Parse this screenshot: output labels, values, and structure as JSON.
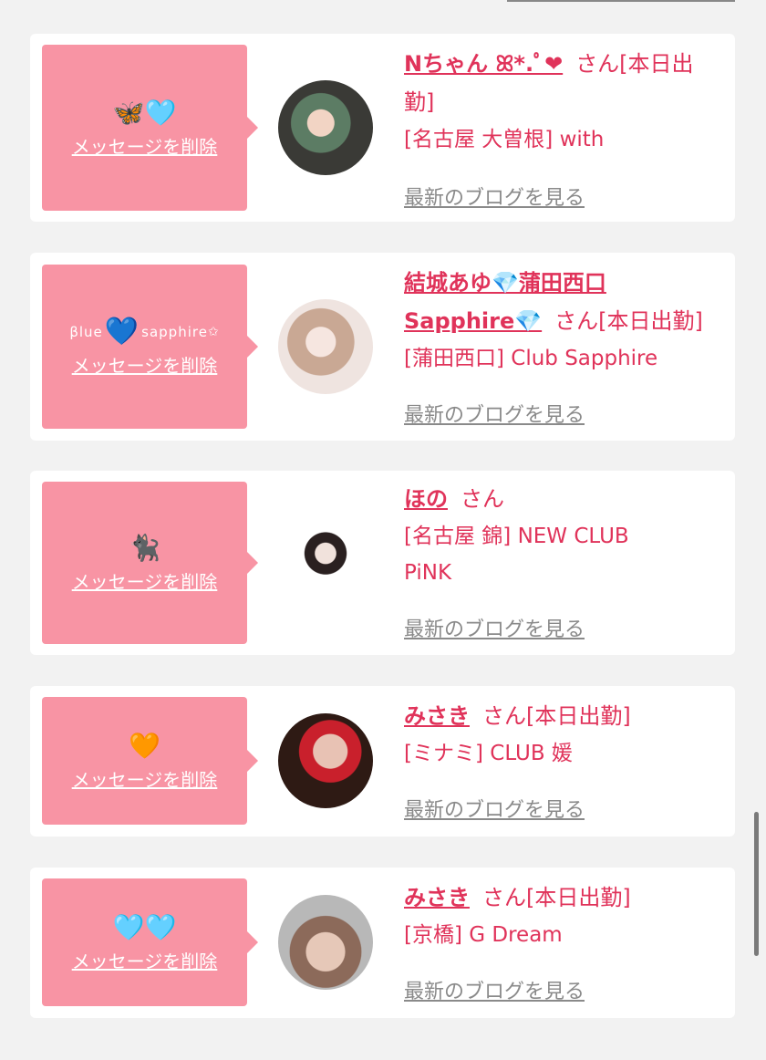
{
  "top": {
    "paren": "( )"
  },
  "cards": [
    {
      "message_emoji": "🦋🩵",
      "delete_label": "メッセージを削除",
      "name": "Nちゃん ꕤ*.ﾟ❤︎",
      "honorific_status": "さん[本日出勤]",
      "shop": "[名古屋 大曽根] with",
      "blog_label": "最新のブログを見る"
    },
    {
      "message_prefix": "βlue",
      "message_heart": "💙",
      "message_suffix": "sapphire",
      "message_star": "✩",
      "delete_label": "メッセージを削除",
      "name_line1": "結城あゆ💎蒲田西口",
      "name_line2": "Sapphire💎",
      "honorific_status": "さん[本日出勤]",
      "shop": "[蒲田西口] Club Sapphire",
      "blog_label": "最新のブログを見る"
    },
    {
      "message_emoji": "🐈‍⬛",
      "delete_label": "メッセージを削除",
      "name": "ほの",
      "honorific": "さん",
      "shop_line1": "[名古屋 錦] NEW CLUB",
      "shop_line2": "PiNK",
      "blog_label": "最新のブログを見る"
    },
    {
      "message_emoji": "🧡",
      "delete_label": "メッセージを削除",
      "name": "みさき",
      "honorific_status": "さん[本日出勤]",
      "shop": "[ミナミ] CLUB 媛",
      "blog_label": "最新のブログを見る"
    },
    {
      "message_emoji": "🩵🩵",
      "delete_label": "メッセージを削除",
      "name": "みさき",
      "honorific_status": "さん[本日出勤]",
      "shop": "[京橋] G Dream",
      "blog_label": "最新のブログを見る"
    }
  ],
  "colors": {
    "accent": "#e0335a",
    "message_box": "#f894a4",
    "link_gray": "#8a8a8a",
    "background": "#f2f2f2"
  }
}
